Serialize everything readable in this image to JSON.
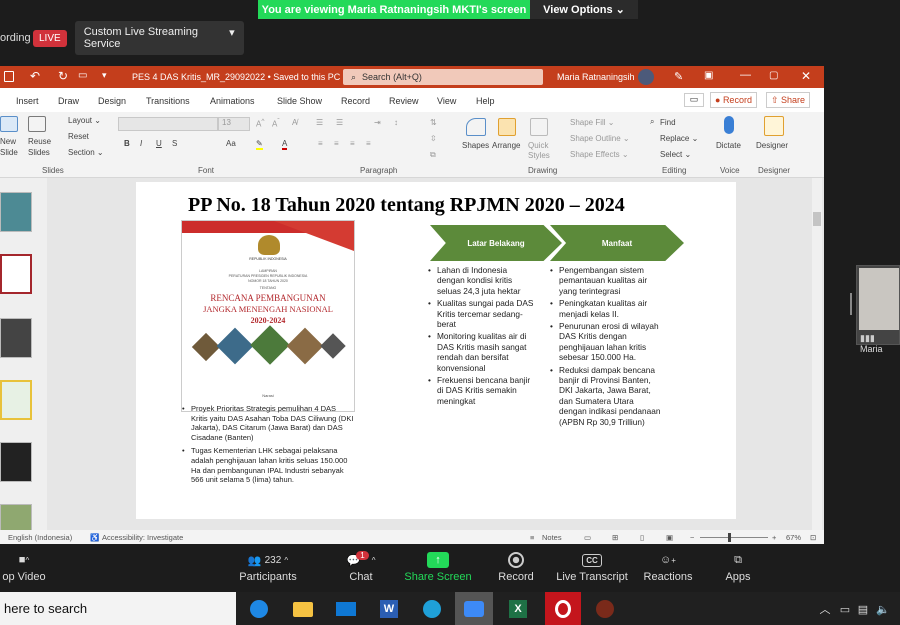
{
  "banner": {
    "message": "You are viewing Maria Ratnaningsih MKTI's screen",
    "view_options": "View Options ⌄"
  },
  "recording": {
    "label": "ording",
    "live": "LIVE",
    "service": "Custom Live Streaming Service",
    "service_caret": "▾"
  },
  "ppt": {
    "filename": "PES 4 DAS Kritis_MR_29092022 • Saved to this PC ⌄",
    "search_placeholder": "Search (Alt+Q)",
    "user": "Maria Ratnaningsih",
    "menu": [
      "Insert",
      "Draw",
      "Design",
      "Transitions",
      "Animations",
      "Slide Show",
      "Record",
      "Review",
      "View",
      "Help"
    ],
    "record_btn": "Record",
    "share_btn": "Share",
    "ribbon": {
      "new_slide": "New\nSlide",
      "reuse_slides": "Reuse\nSlides",
      "layout": "Layout ⌄",
      "reset": "Reset",
      "section": "Section ⌄",
      "font_size": "13",
      "shapes": "Shapes",
      "arrange": "Arrange",
      "quick_styles": "Quick\nStyles",
      "shape_fill": "Shape Fill ⌄",
      "shape_outline": "Shape Outline ⌄",
      "shape_effects": "Shape Effects ⌄",
      "find": "Find",
      "replace": "Replace ⌄",
      "select": "Select ⌄",
      "dictate": "Dictate",
      "designer": "Designer",
      "groups": {
        "slides": "Slides",
        "font": "Font",
        "paragraph": "Paragraph",
        "drawing": "Drawing",
        "editing": "Editing",
        "voice": "Voice",
        "designer": "Designer"
      }
    },
    "status": {
      "language": "English (Indonesia)",
      "accessibility": "Accessibility: Investigate",
      "notes": "Notes",
      "zoom": "67%"
    }
  },
  "slide": {
    "title": "PP No. 18 Tahun 2020 tentang  RPJMN 2020 – 2024",
    "cover": {
      "header1": "REPUBLIK INDONESIA",
      "header2": "LAMPIRAN",
      "header3": "PERATURAN PRESIDEN REPUBLIK INDONESIA",
      "header4": "NOMOR 18 TAHUN 2020",
      "header5": "TENTANG",
      "title1": "RENCANA PEMBANGUNAN",
      "title2": "JANGKA MENENGAH NASIONAL",
      "title3": "2020-2024",
      "footer": "Narasi"
    },
    "arrow1": "Latar Belakang",
    "arrow2": "Manfaat",
    "left_bullets": [
      "Proyek Prioritas Strategis pemulihan 4 DAS Kritis yaitu DAS Asahan Toba DAS Ciliwung (DKI Jakarta), DAS Citarum (Jawa Barat) dan DAS Cisadane (Banten)",
      "Tugas Kementerian LHK sebagai pelaksana adalah penghijauan lahan kritis seluas 150.000 Ha dan pembangunan IPAL Industri sebanyak 566 unit selama 5 (lima) tahun."
    ],
    "mid_bullets": [
      "Lahan di Indonesia dengan kondisi kritis seluas 24,3 juta hektar",
      "Kualitas sungai pada DAS Kritis tercemar sedang-berat",
      "Monitoring kualitas air di DAS Kritis masih sangat rendah dan bersifat konvensional",
      "Frekuensi bencana banjir di DAS Kritis semakin meningkat"
    ],
    "right_bullets": [
      "Pengembangan sistem pemantauan kualitas air yang terintegrasi",
      "Peningkatan kualitas air menjadi kelas II.",
      "Penurunan erosi di wilayah DAS Kritis dengan penghijauan lahan kritis sebesar 150.000 Ha.",
      "Reduksi dampak bencana banjir di Provinsi Banten, DKI Jakarta, Jawa Barat, dan Sumatera Utara dengan indikasi pendanaan (APBN Rp 30,9  Trilliun)"
    ]
  },
  "participant": {
    "name": "Maria"
  },
  "zoom": {
    "stop_video": "op Video",
    "participants": "Participants",
    "participants_count": "232",
    "chat": "Chat",
    "chat_badge": "1",
    "share_screen": "Share Screen",
    "record": "Record",
    "cc": "CC",
    "live_transcript": "Live Transcript",
    "reactions": "Reactions",
    "apps": "Apps"
  },
  "taskbar": {
    "search": "here to search"
  },
  "colors": {
    "ppt_accent": "#c43e1c",
    "zoom_green": "#23d959",
    "arrow_green": "#5c8a3a",
    "live_red": "#d1323b"
  }
}
